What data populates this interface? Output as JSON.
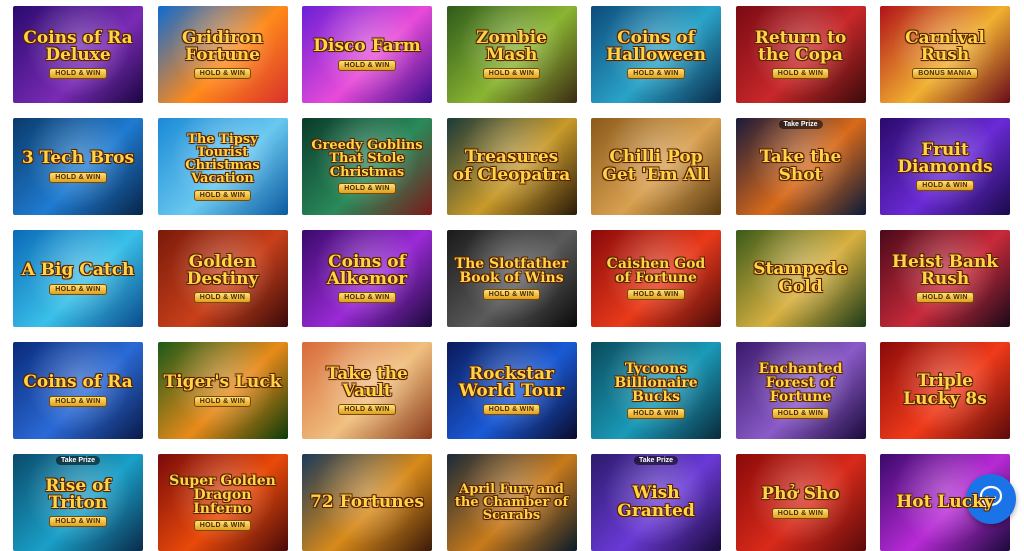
{
  "games": [
    {
      "title": "Coins of Ra Deluxe",
      "badge": "HOLD & WIN",
      "tag": "",
      "bg": "linear-gradient(135deg,#2a0a6e,#7a2bb5 60%,#1a0640)"
    },
    {
      "title": "Gridiron Fortune",
      "badge": "HOLD & WIN",
      "tag": "",
      "bg": "linear-gradient(135deg,#0f6bd1,#ff8a1a 55%,#d9302c)"
    },
    {
      "title": "Disco Farm",
      "badge": "HOLD & WIN",
      "tag": "",
      "bg": "linear-gradient(135deg,#6b1fd6,#e84bd8 55%,#3a0e8a)"
    },
    {
      "title": "Zombie Mash",
      "badge": "HOLD & WIN",
      "tag": "",
      "bg": "linear-gradient(135deg,#2e5a1a,#8ab532 55%,#3c2a14)"
    },
    {
      "title": "Coins of Halloween",
      "badge": "HOLD & WIN",
      "tag": "",
      "bg": "linear-gradient(135deg,#0c4a7a,#2aa3c8 55%,#0a2a4a)"
    },
    {
      "title": "Return to the Copa",
      "badge": "HOLD & WIN",
      "tag": "",
      "bg": "linear-gradient(135deg,#7a0a14,#c8282a 55%,#3a0a0a)"
    },
    {
      "title": "Carnival Rush",
      "badge": "BONUS MANIA",
      "tag": "",
      "bg": "linear-gradient(135deg,#b2121a,#f0b030 55%,#6a0a1a)"
    },
    {
      "title": "3 Tech Bros",
      "badge": "HOLD & WIN",
      "tag": "",
      "bg": "linear-gradient(135deg,#0a3a6a,#1f7bd1 55%,#082448)"
    },
    {
      "title": "The Tipsy Tourist Christmas Vacation",
      "badge": "HOLD & WIN",
      "tag": "",
      "bg": "linear-gradient(135deg,#1a8ad6,#6ac8f0 55%,#0a5aa0)"
    },
    {
      "title": "Greedy Goblins That Stole Christmas",
      "badge": "HOLD & WIN",
      "tag": "",
      "bg": "linear-gradient(135deg,#0a3a2a,#2a8a5a 55%,#7a1a1a)"
    },
    {
      "title": "Treasures of Cleopatra",
      "badge": "",
      "tag": "",
      "bg": "linear-gradient(135deg,#1a3a3a,#c89a2a 55%,#2a1a0a)"
    },
    {
      "title": "Chilli Pop Get 'Em All",
      "badge": "",
      "tag": "",
      "bg": "linear-gradient(135deg,#8a5a1a,#d8a050 55%,#5a3a10)"
    },
    {
      "title": "Take the Shot",
      "badge": "",
      "tag": "Take Prize",
      "bg": "linear-gradient(135deg,#1a1a3a,#d86a1a 55%,#0a1a3a)"
    },
    {
      "title": "Fruit Diamonds",
      "badge": "HOLD & WIN",
      "tag": "",
      "bg": "linear-gradient(135deg,#2a0a6a,#6a2ad6 55%,#1a0a4a)"
    },
    {
      "title": "A Big Catch",
      "badge": "HOLD & WIN",
      "tag": "",
      "bg": "linear-gradient(135deg,#0a6ab8,#3ac0e8 55%,#0a4a8a)"
    },
    {
      "title": "Golden Destiny",
      "badge": "HOLD & WIN",
      "tag": "",
      "bg": "linear-gradient(135deg,#7a1a0a,#c8401a 55%,#3a0a0a)"
    },
    {
      "title": "Coins of Alkemor",
      "badge": "HOLD & WIN",
      "tag": "",
      "bg": "linear-gradient(135deg,#3a0a6a,#9a2ad6 55%,#1a0a3a)"
    },
    {
      "title": "The Slotfather Book of Wins",
      "badge": "HOLD & WIN",
      "tag": "",
      "bg": "linear-gradient(135deg,#1a1a1a,#5a5a5a 55%,#0a0a0a)"
    },
    {
      "title": "Caishen God of Fortune",
      "badge": "HOLD & WIN",
      "tag": "",
      "bg": "linear-gradient(135deg,#8a0a0a,#e83a1a 55%,#4a0a0a)"
    },
    {
      "title": "Stampede Gold",
      "badge": "",
      "tag": "",
      "bg": "linear-gradient(135deg,#3a5a1a,#d8b040 55%,#1a3a1a)"
    },
    {
      "title": "Heist Bank Rush",
      "badge": "HOLD & WIN",
      "tag": "",
      "bg": "linear-gradient(135deg,#4a0a1a,#c82a3a 55%,#1a0a1a)"
    },
    {
      "title": "Coins of Ra",
      "badge": "HOLD & WIN",
      "tag": "",
      "bg": "linear-gradient(135deg,#0a2a7a,#2a6ad6 55%,#0a1a4a)"
    },
    {
      "title": "Tiger's Luck",
      "badge": "HOLD & WIN",
      "tag": "",
      "bg": "linear-gradient(135deg,#1a5a1a,#e88a1a 55%,#0a3a0a)"
    },
    {
      "title": "Take the Vault",
      "badge": "HOLD & WIN",
      "tag": "",
      "bg": "linear-gradient(135deg,#d86a3a,#f0c080 55%,#8a3a1a)"
    },
    {
      "title": "Rockstar World Tour",
      "badge": "HOLD & WIN",
      "tag": "",
      "bg": "linear-gradient(135deg,#0a1a5a,#1a5ad6 55%,#0a0a2a)"
    },
    {
      "title": "Tycoons Billionaire Bucks",
      "badge": "HOLD & WIN",
      "tag": "",
      "bg": "linear-gradient(135deg,#0a4a5a,#1a9ab8 55%,#0a2a3a)"
    },
    {
      "title": "Enchanted Forest of Fortune",
      "badge": "HOLD & WIN",
      "tag": "",
      "bg": "linear-gradient(135deg,#3a1a6a,#8a5ac8 55%,#1a0a3a)"
    },
    {
      "title": "Triple Lucky 8s",
      "badge": "",
      "tag": "",
      "bg": "linear-gradient(135deg,#8a0a0a,#f03a1a 55%,#5a0a0a)"
    },
    {
      "title": "Rise of Triton",
      "badge": "HOLD & WIN",
      "tag": "Take Prize",
      "bg": "linear-gradient(135deg,#0a4a6a,#1aa0c8 55%,#0a2a4a)"
    },
    {
      "title": "Super Golden Dragon Inferno",
      "badge": "HOLD & WIN",
      "tag": "",
      "bg": "linear-gradient(135deg,#7a0a0a,#e84a0a 55%,#4a0a0a)"
    },
    {
      "title": "72 Fortunes",
      "badge": "",
      "tag": "",
      "bg": "linear-gradient(135deg,#1a3a5a,#d88a1a 55%,#3a1a0a)"
    },
    {
      "title": "April Fury and the Chamber of Scarabs",
      "badge": "",
      "tag": "",
      "bg": "linear-gradient(135deg,#1a2a3a,#c87a1a 55%,#0a1a2a)"
    },
    {
      "title": "Wish Granted",
      "badge": "",
      "tag": "Take Prize",
      "bg": "linear-gradient(135deg,#2a1a6a,#6a3ad6 55%,#1a0a3a)"
    },
    {
      "title": "Phở Sho",
      "badge": "HOLD & WIN",
      "tag": "",
      "bg": "linear-gradient(135deg,#8a0a0a,#d82a1a 55%,#5a0a0a)"
    },
    {
      "title": "Hot Lucky",
      "badge": "",
      "tag": "",
      "bg": "linear-gradient(135deg,#3a0a6a,#b82ad6 55%,#1a0a3a)"
    }
  ],
  "chat_widget": {
    "icon": "chat-bubble-icon",
    "color": "#1b73e8"
  }
}
